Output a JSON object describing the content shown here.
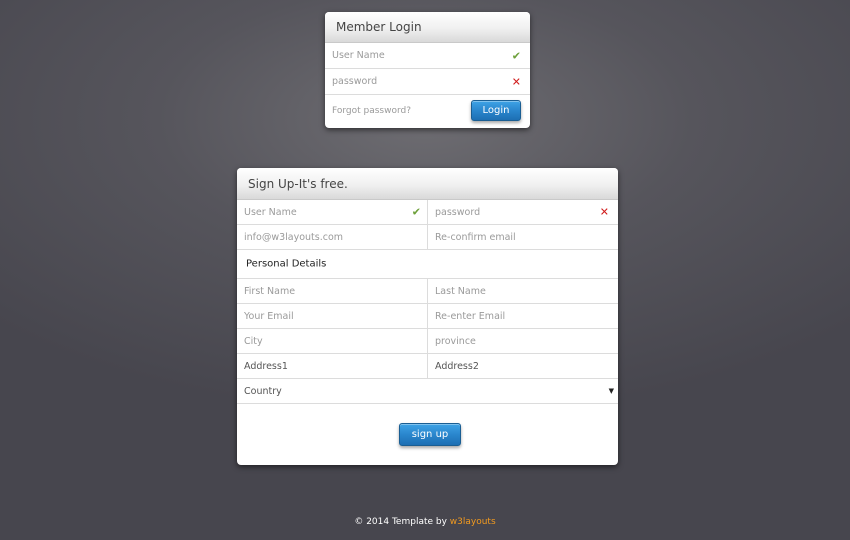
{
  "login": {
    "title": "Member Login",
    "username_placeholder": "User Name",
    "password_placeholder": "password",
    "forgot_label": "Forgot password?",
    "submit_label": "Login"
  },
  "signup": {
    "title": "Sign Up-It's free.",
    "username_placeholder": "User Name",
    "password_placeholder": "password",
    "email_placeholder": "info@w3layouts.com",
    "reconfirm_email_placeholder": "Re-confirm email",
    "personal_details_title": "Personal Details",
    "first_name_placeholder": "First Name",
    "last_name_placeholder": "Last Name",
    "your_email_placeholder": "Your Email",
    "reenter_email_placeholder": "Re-enter Email",
    "city_placeholder": "City",
    "province_placeholder": "province",
    "address1_value": "Address1",
    "address2_value": "Address2",
    "country_selected": "Country",
    "submit_label": "sign up"
  },
  "footer": {
    "text": "© 2014 Template by",
    "link_label": "w3layouts"
  },
  "icons": {
    "valid": "checkmark-icon",
    "invalid": "cross-icon",
    "dropdown": "caret-down-icon"
  },
  "colors": {
    "accent_button": "#2a86cd",
    "valid_icon": "#6da03a",
    "invalid_icon": "#d01a1a",
    "footer_link": "#f29a1f"
  }
}
